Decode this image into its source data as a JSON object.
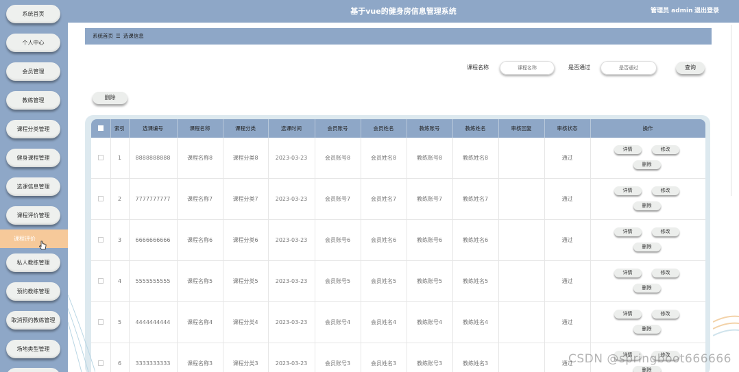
{
  "app": {
    "title": "基于vue的健身房信息管理系统",
    "admin": "管理员 admin",
    "logout": "退出登录"
  },
  "sidebar": {
    "items": [
      {
        "label": "系统首页"
      },
      {
        "label": "个人中心"
      },
      {
        "label": "会员管理"
      },
      {
        "label": "教练管理"
      },
      {
        "label": "课程分类管理"
      },
      {
        "label": "健身课程管理"
      },
      {
        "label": "选课信息管理"
      },
      {
        "label": "课程评价管理"
      },
      {
        "label": "课程评价"
      },
      {
        "label": "私人教练管理"
      },
      {
        "label": "预约教练管理"
      },
      {
        "label": "取消预约教练管理"
      },
      {
        "label": "场地类型管理"
      }
    ]
  },
  "breadcrumb": {
    "home": "系统首页",
    "sep": "☰",
    "current": "选课信息"
  },
  "search": {
    "course_label": "课程名称",
    "course_placeholder": "课程名称",
    "pass_label": "是否通过",
    "pass_placeholder": "是否通过",
    "query_button": "查询"
  },
  "toolbar": {
    "delete_button": "删除"
  },
  "table": {
    "headers": [
      "",
      "索引",
      "选课编号",
      "课程名称",
      "课程分类",
      "选课时间",
      "会员账号",
      "会员姓名",
      "教练账号",
      "教练姓名",
      "审核回复",
      "审核状态",
      "操作"
    ],
    "actions": {
      "detail": "详情",
      "edit": "修改",
      "delete": "删除"
    },
    "rows": [
      {
        "idx": "1",
        "code": "8888888888",
        "course": "课程名称8",
        "category": "课程分类8",
        "time": "2023-03-23",
        "member_acc": "会员账号8",
        "member_name": "会员姓名8",
        "coach_acc": "教练账号8",
        "coach_name": "教练姓名8",
        "reply": "",
        "status": "通过"
      },
      {
        "idx": "2",
        "code": "7777777777",
        "course": "课程名称7",
        "category": "课程分类7",
        "time": "2023-03-23",
        "member_acc": "会员账号7",
        "member_name": "会员姓名7",
        "coach_acc": "教练账号7",
        "coach_name": "教练姓名7",
        "reply": "",
        "status": "通过"
      },
      {
        "idx": "3",
        "code": "6666666666",
        "course": "课程名称6",
        "category": "课程分类6",
        "time": "2023-03-23",
        "member_acc": "会员账号6",
        "member_name": "会员姓名6",
        "coach_acc": "教练账号6",
        "coach_name": "教练姓名6",
        "reply": "",
        "status": "通过"
      },
      {
        "idx": "4",
        "code": "5555555555",
        "course": "课程名称5",
        "category": "课程分类5",
        "time": "2023-03-23",
        "member_acc": "会员账号5",
        "member_name": "会员姓名5",
        "coach_acc": "教练账号5",
        "coach_name": "教练姓名5",
        "reply": "",
        "status": "通过"
      },
      {
        "idx": "5",
        "code": "4444444444",
        "course": "课程名称4",
        "category": "课程分类4",
        "time": "2023-03-23",
        "member_acc": "会员账号4",
        "member_name": "会员姓名4",
        "coach_acc": "教练账号4",
        "coach_name": "教练姓名4",
        "reply": "",
        "status": "通过"
      },
      {
        "idx": "6",
        "code": "3333333333",
        "course": "课程名称3",
        "category": "课程分类3",
        "time": "2023-03-23",
        "member_acc": "会员账号3",
        "member_name": "会员姓名3",
        "coach_acc": "教练账号3",
        "coach_name": "教练姓名3",
        "reply": "",
        "status": "通过"
      }
    ]
  },
  "watermark": "CSDN @springboot666666",
  "colors": {
    "primary": "#8ea7c7",
    "active": "#f6c99a",
    "button": "#eceeec"
  }
}
